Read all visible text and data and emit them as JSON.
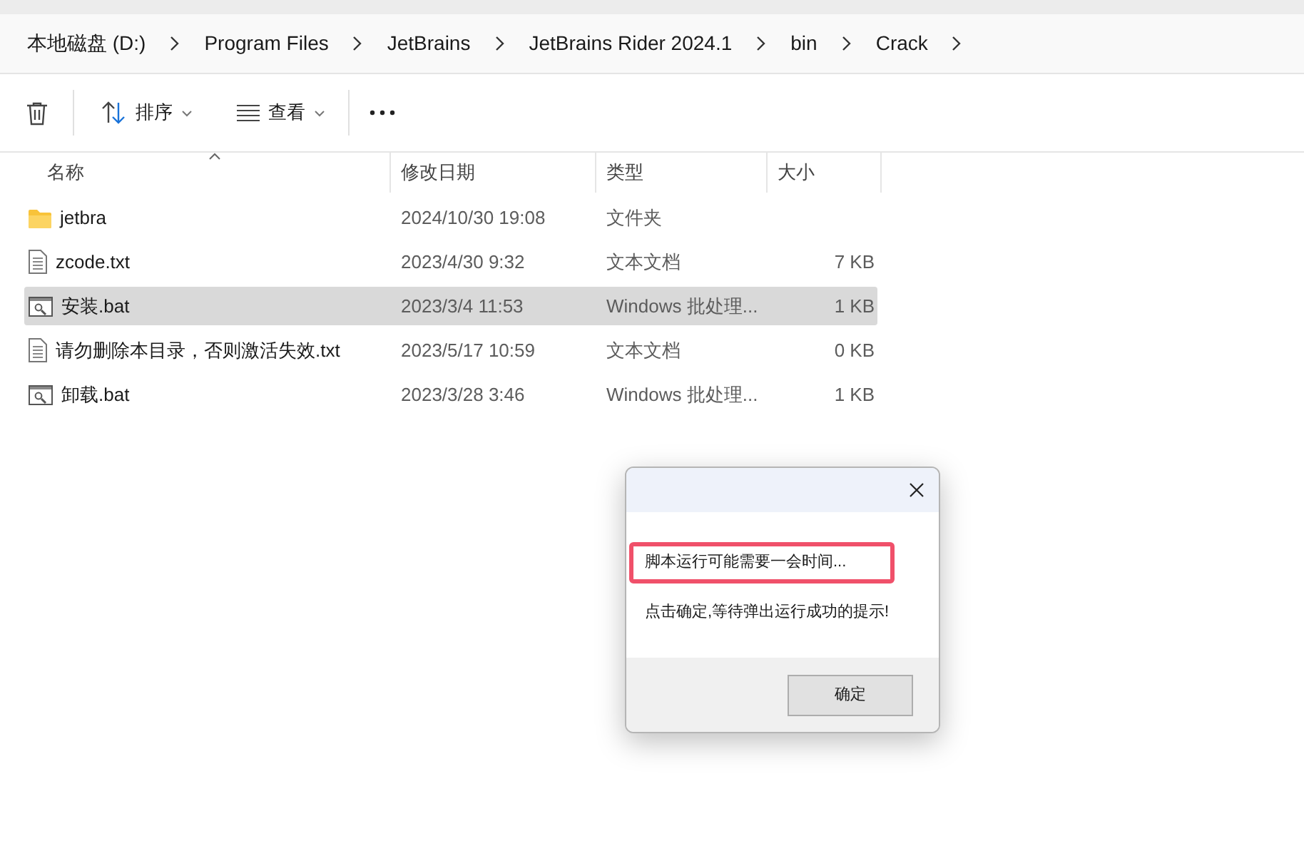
{
  "breadcrumb": [
    "本地磁盘 (D:)",
    "Program Files",
    "JetBrains",
    "JetBrains Rider 2024.1",
    "bin",
    "Crack"
  ],
  "toolbar": {
    "sort": "排序",
    "view": "查看"
  },
  "columns": [
    "名称",
    "修改日期",
    "类型",
    "大小"
  ],
  "files": [
    {
      "name": "jetbra",
      "date": "2024/10/30 19:08",
      "type": "文件夹",
      "kind": "folder",
      "selected": false
    },
    {
      "name": "zcode.txt",
      "date": "2023/4/30 9:32",
      "type": "文本文档",
      "size": "7 KB",
      "kind": "text",
      "selected": false
    },
    {
      "name": "安装.bat",
      "date": "2023/3/4 11:53",
      "type": "Windows 批处理...",
      "size": "1 KB",
      "kind": "batch",
      "selected": true
    },
    {
      "name": "请勿删除本目录，否则激活失效.txt",
      "date": "2023/5/17 10:59",
      "type": "文本文档",
      "size": "0 KB",
      "kind": "text",
      "selected": false
    },
    {
      "name": "卸载.bat",
      "date": "2023/3/28 3:46",
      "type": "Windows 批处理...",
      "size": "1 KB",
      "kind": "batch",
      "selected": false
    }
  ],
  "dialog": {
    "lines": [
      {
        "text": "脚本运行可能需要一会时间...",
        "highlighted": true
      },
      {
        "text": "点击确定,等待弹出运行成功的提示!",
        "highlighted": false
      }
    ],
    "button": "确定"
  }
}
